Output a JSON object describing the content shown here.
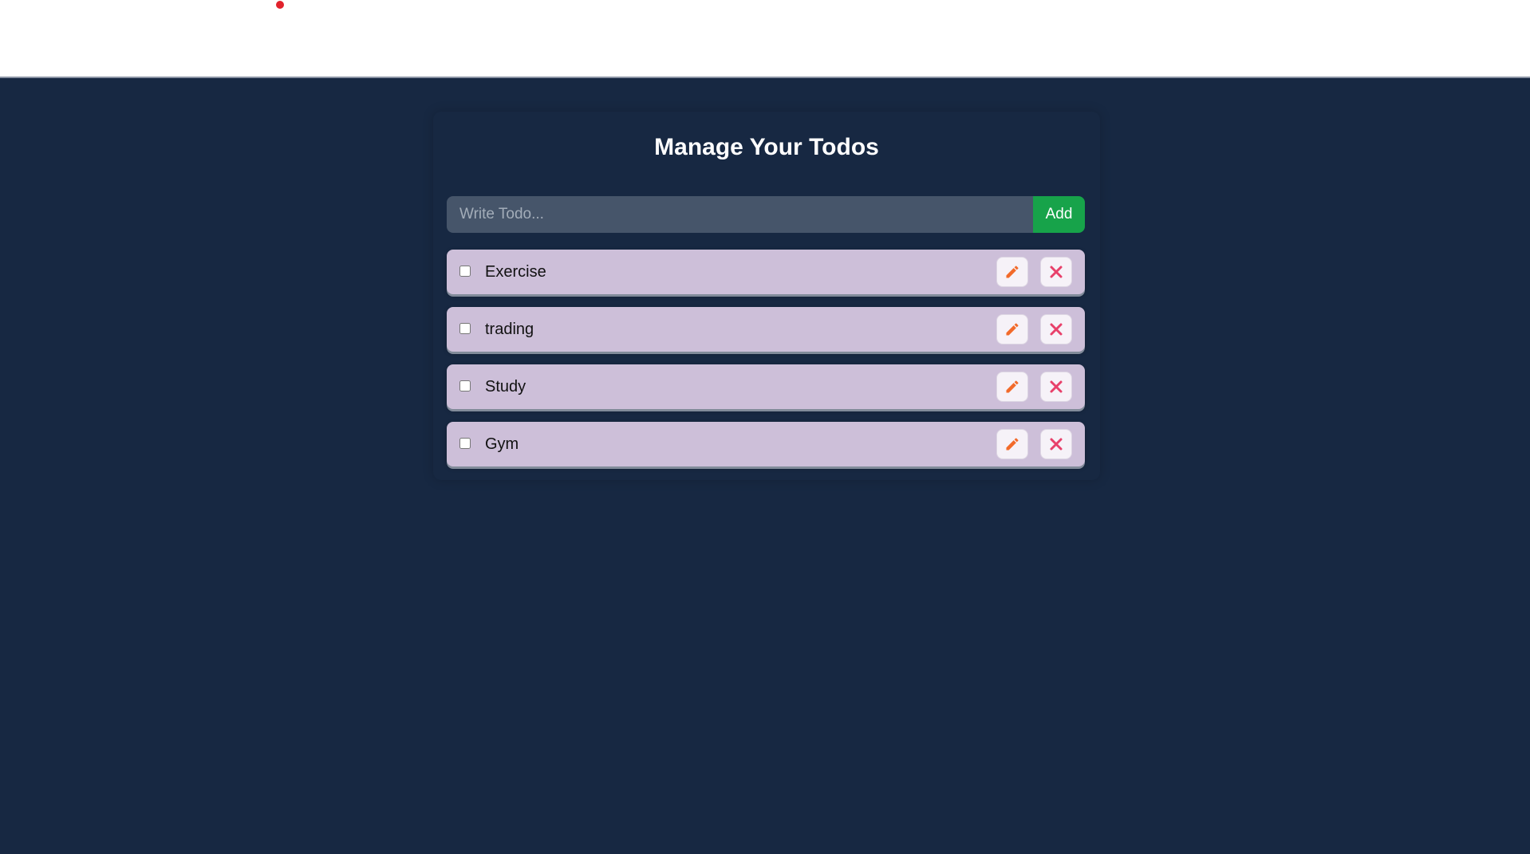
{
  "page": {
    "title": "Manage Your Todos"
  },
  "form": {
    "placeholder": "Write Todo...",
    "value": "",
    "add_label": "Add"
  },
  "todos": [
    {
      "text": "Exercise",
      "completed": false
    },
    {
      "text": "trading",
      "completed": false
    },
    {
      "text": "Study",
      "completed": false
    },
    {
      "text": "Gym",
      "completed": false
    }
  ],
  "icons": {
    "edit": "pencil-icon",
    "delete": "close-icon",
    "indicator": "red-dot"
  },
  "colors": {
    "background": "#172842",
    "header": "#ffffff",
    "input_bg": "#46556a",
    "add_button": "#17a34a",
    "item_bg": "#cdbfd9",
    "edit_icon": "#f26a2a",
    "delete_icon": "#e8406a",
    "indicator": "#e1222c"
  }
}
